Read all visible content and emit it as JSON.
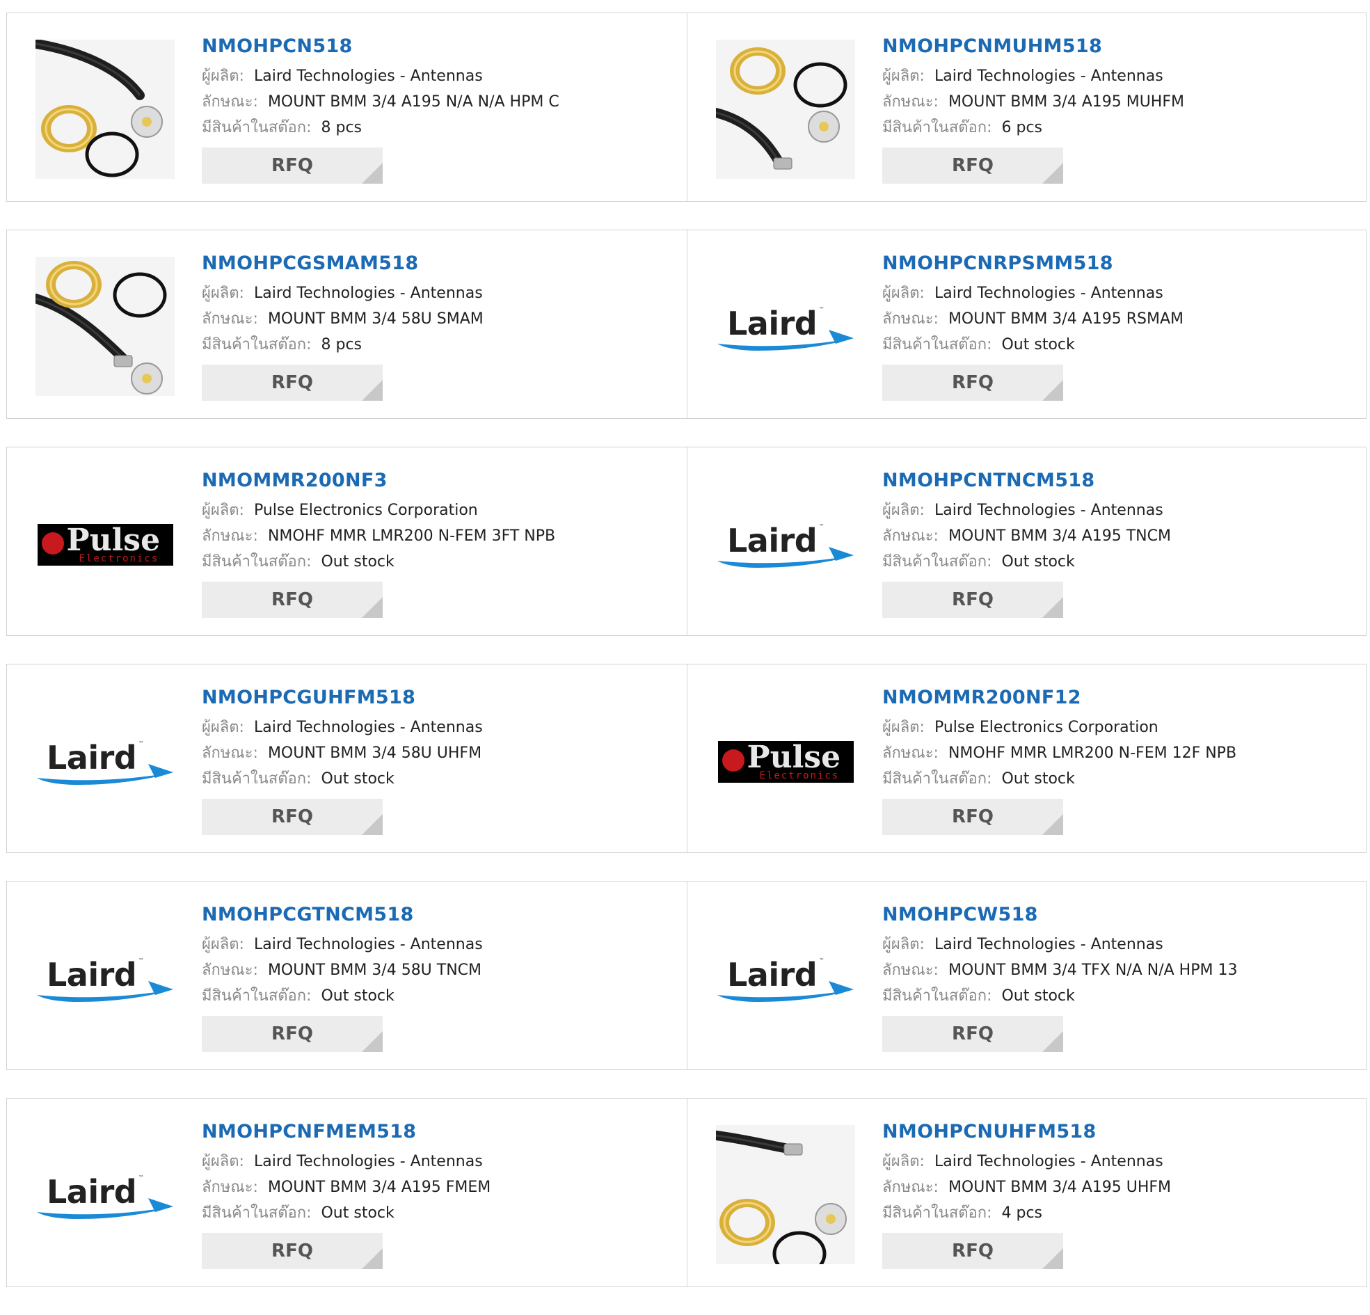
{
  "labels": {
    "manufacturer": "ผู้ผลิต:",
    "description": "ลักษณะ:",
    "stock": "มีสินค้าในสต๊อก:",
    "rfq": "RFQ"
  },
  "colors": {
    "title_link": "#1b6ab3",
    "rfq_bg": "#ececec",
    "border": "#d2d2d2",
    "pulse_red": "#c8191e",
    "laird_blue": "#1b8ad6"
  },
  "brand_logos": {
    "laird": {
      "name": "Laird",
      "tm": "™"
    },
    "pulse": {
      "name": "Pulse",
      "sub": "Electronics"
    }
  },
  "products": [
    {
      "part": "NMOHPCN518",
      "manufacturer": "Laird Technologies - Antennas",
      "description": "MOUNT BMM 3/4 A195 N/A N/A HPM C",
      "stock": "8 pcs",
      "image": "product-photo-cable-mount"
    },
    {
      "part": "NMOHPCNMUHM518",
      "manufacturer": "Laird Technologies - Antennas",
      "description": "MOUNT BMM 3/4 A195 MUHFM",
      "stock": "6 pcs",
      "image": "product-photo-cable-mount"
    },
    {
      "part": "NMOHPCGSMAM518",
      "manufacturer": "Laird Technologies - Antennas",
      "description": "MOUNT BMM 3/4 58U SMAM",
      "stock": "8 pcs",
      "image": "product-photo-cable-mount"
    },
    {
      "part": "NMOHPCNRPSMM518",
      "manufacturer": "Laird Technologies - Antennas",
      "description": "MOUNT BMM 3/4 A195 RSMAM",
      "stock": "Out stock",
      "image": "laird-logo"
    },
    {
      "part": "NMOMMR200NF3",
      "manufacturer": "Pulse Electronics Corporation",
      "description": "NMOHF MMR LMR200 N-FEM 3FT NPB",
      "stock": "Out stock",
      "image": "pulse-logo"
    },
    {
      "part": "NMOHPCNTNCM518",
      "manufacturer": "Laird Technologies - Antennas",
      "description": "MOUNT BMM 3/4 A195 TNCM",
      "stock": "Out stock",
      "image": "laird-logo"
    },
    {
      "part": "NMOHPCGUHFM518",
      "manufacturer": "Laird Technologies - Antennas",
      "description": "MOUNT BMM 3/4 58U UHFM",
      "stock": "Out stock",
      "image": "laird-logo"
    },
    {
      "part": "NMOMMR200NF12",
      "manufacturer": "Pulse Electronics Corporation",
      "description": "NMOHF MMR LMR200 N-FEM 12F NPB",
      "stock": "Out stock",
      "image": "pulse-logo"
    },
    {
      "part": "NMOHPCGTNCM518",
      "manufacturer": "Laird Technologies - Antennas",
      "description": "MOUNT BMM 3/4 58U TNCM",
      "stock": "Out stock",
      "image": "laird-logo"
    },
    {
      "part": "NMOHPCW518",
      "manufacturer": "Laird Technologies - Antennas",
      "description": "MOUNT BMM 3/4 TFX N/A N/A HPM 13",
      "stock": "Out stock",
      "image": "laird-logo"
    },
    {
      "part": "NMOHPCNFMEM518",
      "manufacturer": "Laird Technologies - Antennas",
      "description": "MOUNT BMM 3/4 A195 FMEM",
      "stock": "Out stock",
      "image": "laird-logo"
    },
    {
      "part": "NMOHPCNUHFM518",
      "manufacturer": "Laird Technologies - Antennas",
      "description": "MOUNT BMM 3/4 A195 UHFM",
      "stock": "4 pcs",
      "image": "product-photo-cable-mount"
    }
  ]
}
